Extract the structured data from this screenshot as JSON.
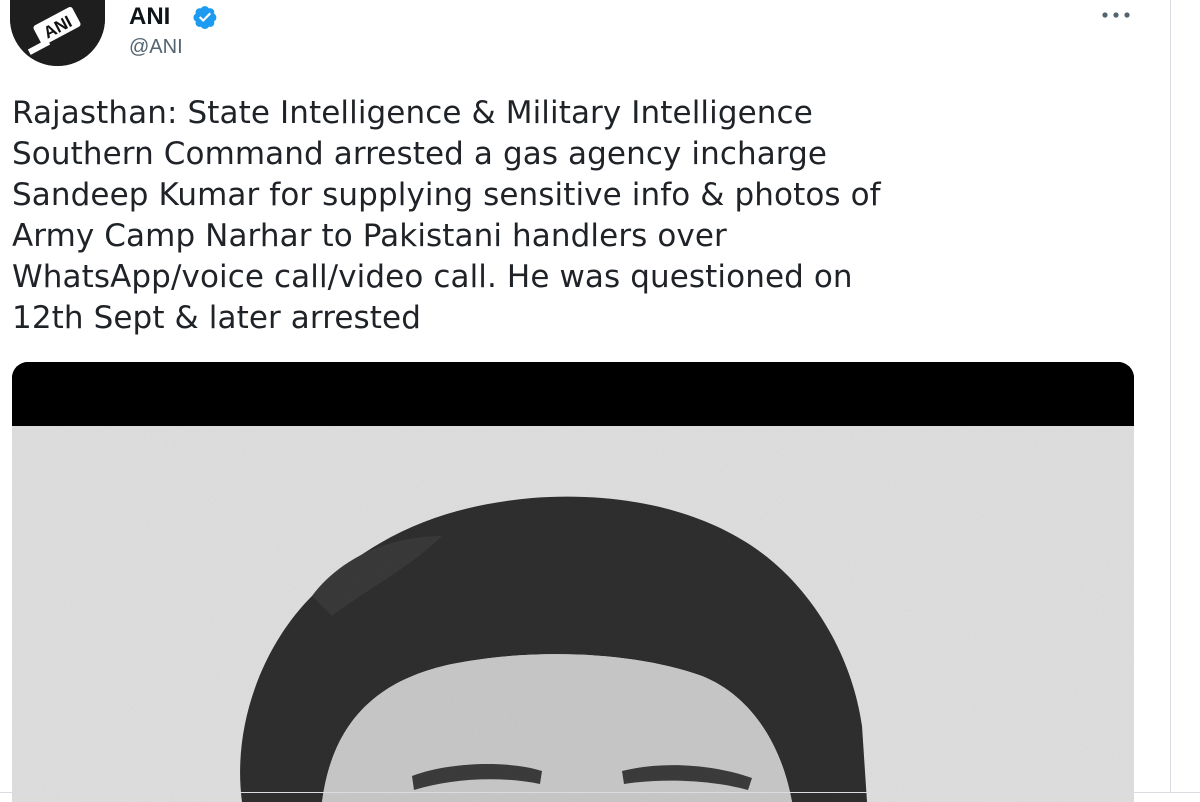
{
  "account": {
    "display_name": "ANI",
    "handle": "@ANI",
    "verified": true,
    "avatar_text": "ANI"
  },
  "tweet": {
    "text": "Rajasthan: State Intelligence & Military Intelligence\nSouthern Command arrested a gas agency incharge\nSandeep Kumar for supplying sensitive info & photos of\nArmy Camp Narhar to Pakistani handlers over\nWhatsApp/voice call/video call. He was questioned on\n12th Sept & later arrested"
  },
  "icons": {
    "verified": "verified-badge-icon",
    "more": "more-options-icon"
  },
  "colors": {
    "verified_blue": "#1d9bf0",
    "handle_gray": "#536471",
    "text": "#0f1419"
  }
}
